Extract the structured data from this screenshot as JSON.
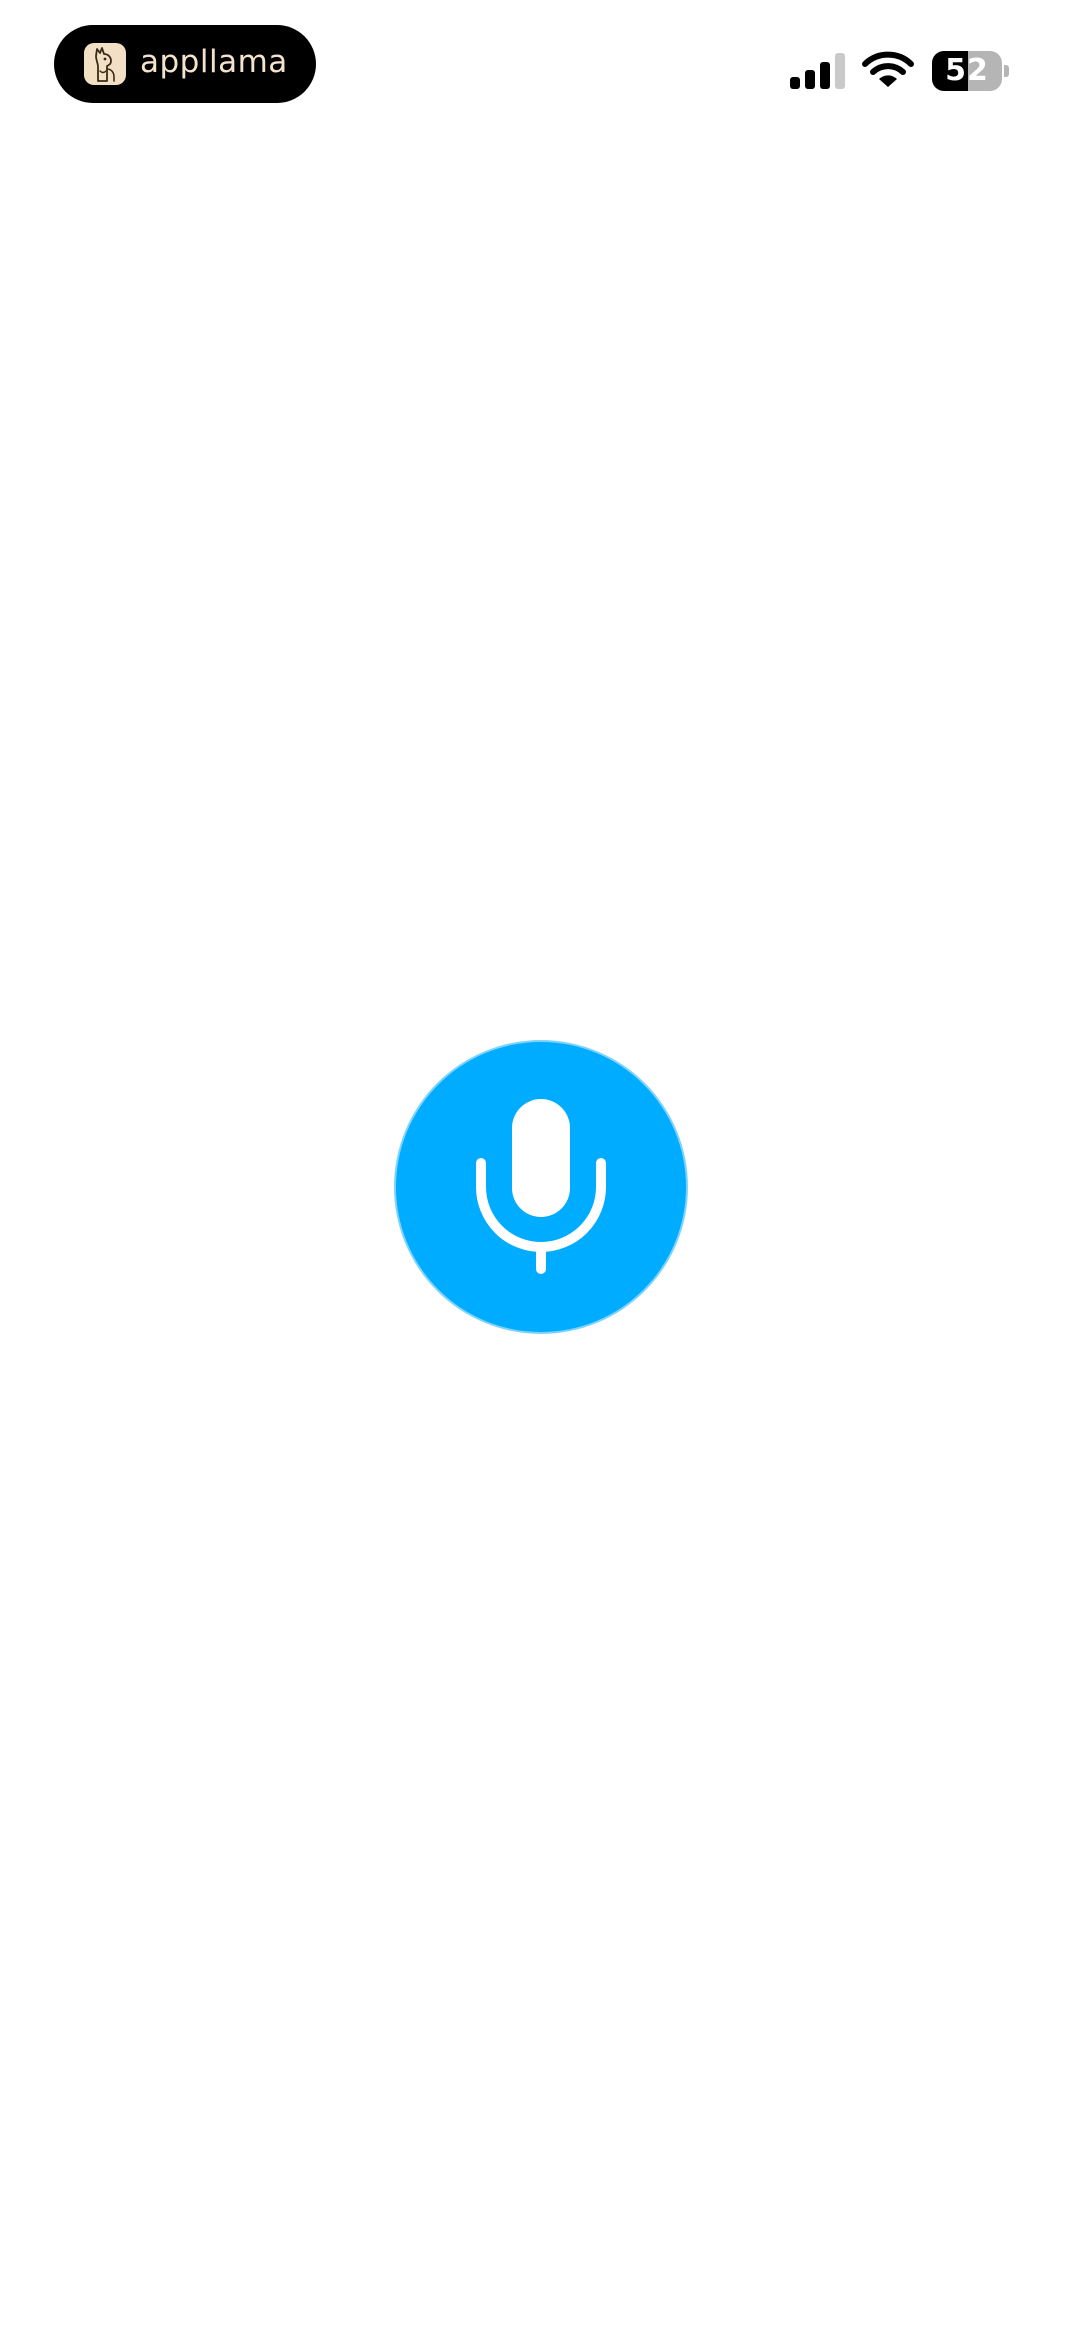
{
  "status_bar": {
    "app_name": "appllama",
    "logo_icon": "llama-logo-icon",
    "signal_icon": "cellular-signal-icon",
    "signal_bars_active": 3,
    "signal_bars_total": 4,
    "wifi_icon": "wifi-icon",
    "battery_icon": "battery-icon",
    "battery_level": "52",
    "battery_fraction": 0.52
  },
  "main": {
    "mic_button_icon": "microphone-icon",
    "mic_button_color": "#00acff"
  },
  "colors": {
    "accent": "#00acff",
    "pill_background": "#000000",
    "pill_text": "#f4e4cc",
    "background": "#ffffff"
  }
}
